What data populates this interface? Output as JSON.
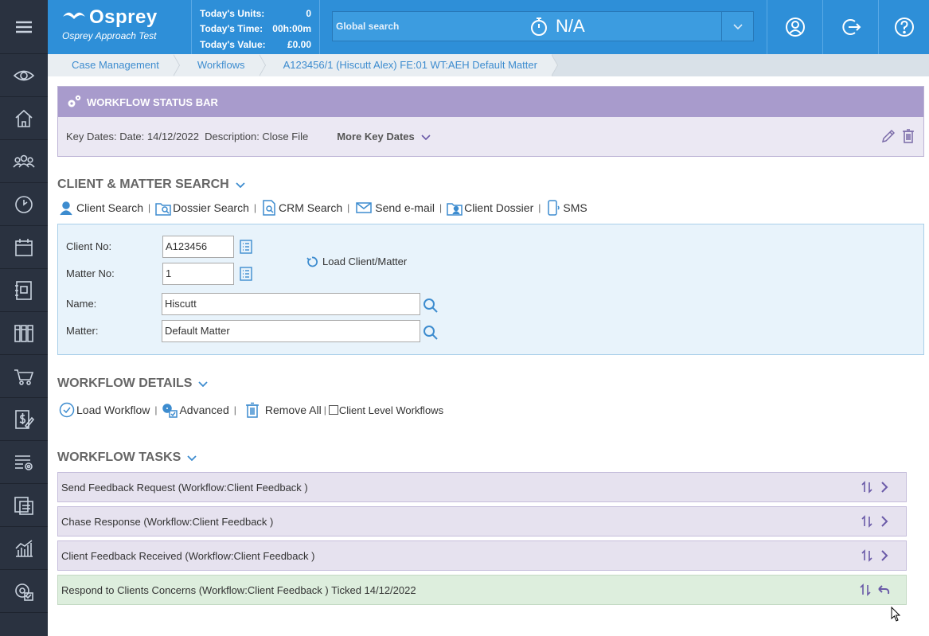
{
  "app": {
    "brand": "Osprey",
    "brand_small": "Approach",
    "subtitle": "Osprey Approach Test"
  },
  "stats": [
    {
      "label": "Today's Units:",
      "value": "0"
    },
    {
      "label": "Today's Time:",
      "value": "00h:00m"
    },
    {
      "label": "Today's Value:",
      "value": "£0.00"
    }
  ],
  "search": {
    "placeholder": "Global search",
    "timer_value": "N/A"
  },
  "sidebar": {
    "items": [
      "menu-icon",
      "eye-icon",
      "home-icon",
      "users-icon",
      "clock-icon",
      "calendar-icon",
      "document-icon",
      "books-icon",
      "cart-icon",
      "billing-icon",
      "settings-list-icon",
      "copy-icon",
      "chart-icon",
      "config-icon"
    ]
  },
  "breadcrumb": [
    "Case Management",
    "Workflows",
    "A123456/1 (Hiscutt Alex) FE:01 WT:AEH Default Matter"
  ],
  "status_bar": {
    "title": "WORKFLOW STATUS BAR",
    "key_dates": "Key Dates: Date: 14/12/2022  Description: Close File",
    "more": "More Key Dates"
  },
  "client_matter": {
    "title": "CLIENT & MATTER SEARCH",
    "toolbar": [
      "Client Search",
      "Dossier Search",
      "CRM Search",
      "Send e-mail",
      "Client Dossier",
      "SMS"
    ],
    "client_no_label": "Client No:",
    "client_no": "A123456",
    "matter_no_label": "Matter No:",
    "matter_no": "1",
    "name_label": "Name:",
    "name": "Hiscutt",
    "matter_label": "Matter:",
    "matter": "Default Matter",
    "load_label": "Load Client/Matter"
  },
  "workflow_details": {
    "title": "WORKFLOW DETAILS",
    "toolbar": [
      "Load Workflow",
      "Advanced",
      "Remove All"
    ],
    "checkbox_label": "Client Level Workflows"
  },
  "workflow_tasks": {
    "title": "WORKFLOW TASKS",
    "tasks": [
      {
        "label": "Send Feedback Request (Workflow:Client Feedback )",
        "status": "open"
      },
      {
        "label": "Chase Response (Workflow:Client Feedback )",
        "status": "open"
      },
      {
        "label": "Client Feedback Received (Workflow:Client Feedback )",
        "status": "open"
      },
      {
        "label": "Respond to Clients Concerns (Workflow:Client Feedback ) Ticked 14/12/2022",
        "status": "done"
      }
    ]
  },
  "colors": {
    "header": "#2e8fd8",
    "sidebar": "#2a3240",
    "status_bar": "#a89bcc",
    "task_open": "#e6e2ef",
    "task_done": "#ddeedd"
  }
}
